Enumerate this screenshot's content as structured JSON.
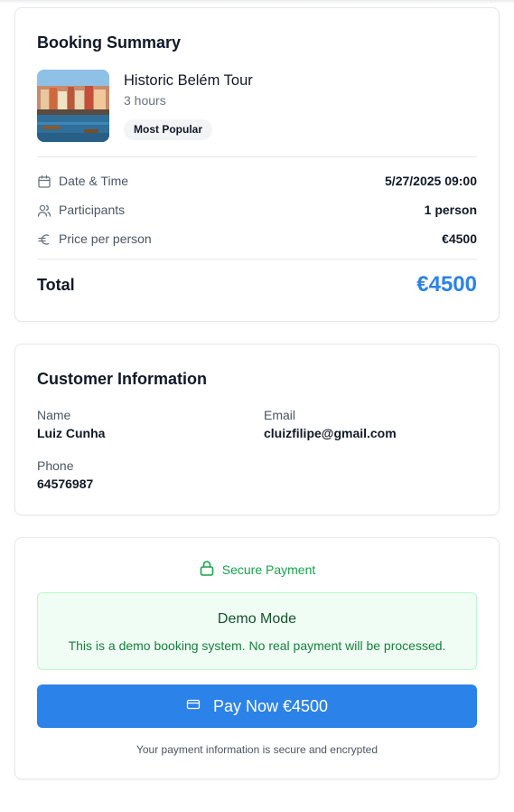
{
  "summary": {
    "title": "Booking Summary",
    "tour": {
      "name": "Historic Belém Tour",
      "duration": "3 hours",
      "badge": "Most Popular"
    },
    "details": [
      {
        "icon": "calendar-icon",
        "label": "Date & Time",
        "value": "5/27/2025 09:00"
      },
      {
        "icon": "users-icon",
        "label": "Participants",
        "value": "1 person"
      },
      {
        "icon": "euro-icon",
        "label": "Price per person",
        "value": "€4500"
      }
    ],
    "total_label": "Total",
    "total_value": "€4500"
  },
  "customer": {
    "title": "Customer Information",
    "name_label": "Name",
    "name_value": "Luiz Cunha",
    "email_label": "Email",
    "email_value": "cluizfilipe@gmail.com",
    "phone_label": "Phone",
    "phone_value": "64576987"
  },
  "payment": {
    "secure_label": "Secure Payment",
    "demo_title": "Demo Mode",
    "demo_text": "This is a demo booking system. No real payment will be processed.",
    "pay_button_label": "Pay Now €4500",
    "secure_note": "Your payment information is secure and encrypted"
  },
  "colors": {
    "accent": "#2b82e8",
    "success": "#16a34a",
    "success_bg": "#f0fdf4",
    "border": "#e5e7eb"
  }
}
